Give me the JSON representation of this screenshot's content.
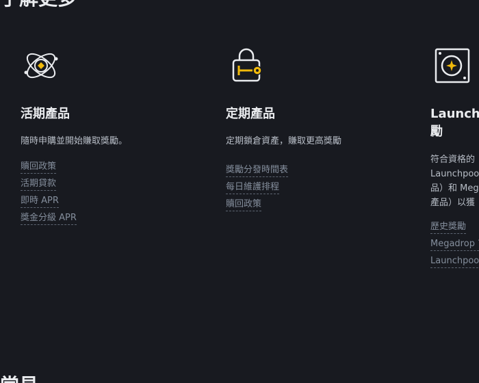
{
  "section": {
    "title": "了解更多",
    "bottom_title": "常見"
  },
  "cards": [
    {
      "icon": "atom-orbit-icon",
      "title": "活期產品",
      "description": "隨時申購並開始賺取獎勵。",
      "links": [
        "贖回政策",
        "活期貸款",
        "即時 APR",
        "獎金分級 APR"
      ]
    },
    {
      "icon": "lock-key-icon",
      "title": "定期產品",
      "description": "定期鎖倉資產，賺取更高獎勵",
      "links": [
        "獎勵分發時間表",
        "每日維護排程",
        "贖回政策"
      ]
    },
    {
      "icon": "sparkle-square-icon",
      "title_line1": "Launchp",
      "title_line2": "勵",
      "desc_line1": "符合資格的",
      "desc_line2": "Launchpool",
      "desc_line3": "品）和 Meg",
      "desc_line4": "產品）以獲",
      "links": [
        "歷史獎勵",
        "Megadrop ?",
        "Launchpool"
      ]
    }
  ],
  "colors": {
    "background": "#181a20",
    "accent": "#f0b90b",
    "title_text": "#eaecef",
    "body_text": "#b7bdc6",
    "link_text": "#848e9c"
  }
}
